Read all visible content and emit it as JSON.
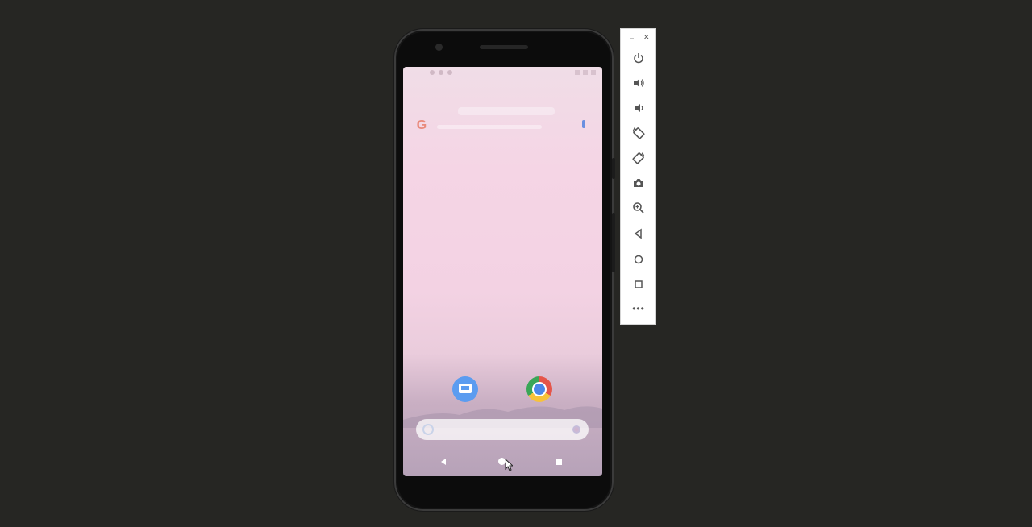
{
  "emulator_toolbar": {
    "minimize_glyph": "–",
    "close_glyph": "✕",
    "more_glyph": "•••",
    "buttons": [
      {
        "icon": "power-icon"
      },
      {
        "icon": "volume-up-icon"
      },
      {
        "icon": "volume-down-icon"
      },
      {
        "icon": "rotate-left-icon"
      },
      {
        "icon": "rotate-right-icon"
      },
      {
        "icon": "camera-icon"
      },
      {
        "icon": "zoom-icon"
      },
      {
        "icon": "back-icon"
      },
      {
        "icon": "home-icon"
      },
      {
        "icon": "overview-icon"
      }
    ]
  },
  "home_screen": {
    "search_logo": "G",
    "apps": [
      {
        "name": "messages-app-icon"
      },
      {
        "name": "chrome-app-icon"
      }
    ]
  },
  "colors": {
    "background": "#262623",
    "wallpaper_top": "#f0dde7",
    "wallpaper_bottom": "#b6a2b8",
    "toolbar": "#ffffff"
  }
}
